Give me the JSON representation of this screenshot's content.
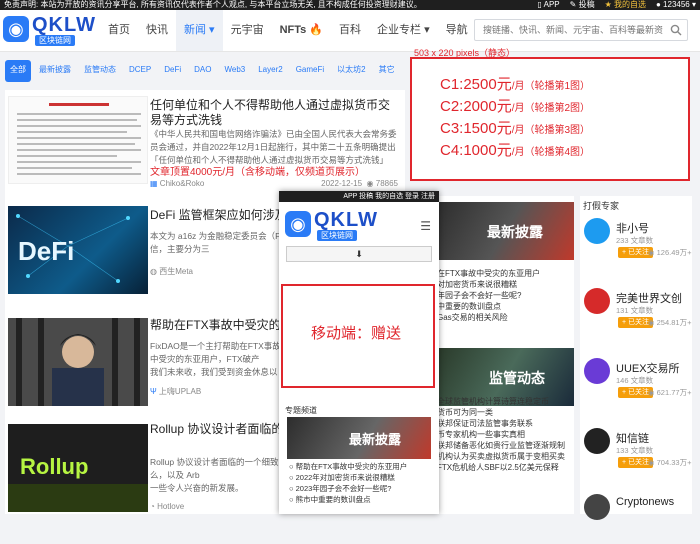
{
  "topbar": {
    "notice": "免责声明: 本站为开放的资讯分享平台, 所有资讯仅代表作者个人观点, 与本平台立场无关, 且不构成任何投资理财建议。",
    "app": "APP",
    "submit": "投稿",
    "fav": "我的自选",
    "user": "123456"
  },
  "logo": {
    "word": "QKLW",
    "sub": "区块链网"
  },
  "menu": [
    "首页",
    "快讯",
    "新闻",
    "元宇宙",
    "NFTs",
    "百科",
    "企业专栏",
    "导航"
  ],
  "search": {
    "placeholder": "搜链播、快讯、新闻、元宇宙、百科等最新资讯"
  },
  "tags": [
    "全部",
    "最新披露",
    "监管动态",
    "DCEP",
    "DeFi",
    "DAO",
    "Web3",
    "Layer2",
    "GameFi",
    "以太坊2",
    "其它"
  ],
  "banner": {
    "label": "503 x 220 pixels（静态）",
    "lines": [
      {
        "price": "C1:2500元",
        "unit": "/月",
        "note": "（轮播第1图）"
      },
      {
        "price": "C2:2000元",
        "unit": "/月",
        "note": "（轮播第2图）"
      },
      {
        "price": "C3:1500元",
        "unit": "/月",
        "note": "（轮播第3图）"
      },
      {
        "price": "C4:1000元",
        "unit": "/月",
        "note": "（轮播第4图）"
      }
    ]
  },
  "articles": [
    {
      "title": "任何单位和个人不得帮助他人通过虚拟货币交易等方式洗钱",
      "desc": "《中华人民共和国电信网络诈骗法》已由全国人民代表大会常务委员会通过，并自2022年12月1日起施行，其中第二十五条明确提出「任何单位和个人不得帮助他人通过虚拟货币交易等方式洗钱」",
      "badge": "置顶",
      "promo": "文章顶置4000元/月（含移动端，仅频道页展示）",
      "author": "Chiko&Roko",
      "date": "2022-12-15",
      "views": "78865"
    },
    {
      "title": "DeFi 监管框架应如何涉及监管",
      "desc": "本文为 a16z 为金融稳定委员会（FSB）主题活动所撰写的评论信，主要分为三",
      "author": "西生Meta",
      "thumb": "DeFi"
    },
    {
      "title": "帮助在FTX事故中受灾的东亚用户",
      "desc": "FixDAO是一个主打帮助在FTX事故中受灾的东亚用户，FTX事故中受灾的东亚用户，FTX破产",
      "desc2": "我们未来收，我们受到资金休息以",
      "author": "上嗨UPLAB"
    },
    {
      "title": "Rollup 协议设计者面临的一个攻击",
      "desc": "Rollup 协议设计者面临的一个细致问题事中，我将讨论它们是什么，以及 Arb",
      "desc2": "一些令人兴奋的新发展。",
      "author": "Hotlove",
      "thumb": "Rollup"
    }
  ],
  "mobile": {
    "topbar": "APP  投稿  我的自选  登录  注册",
    "word": "QKLW",
    "sub": "区块链网",
    "arrow": "⬇",
    "ad": "移动端：赠送",
    "channel": "专题频道",
    "banner": "最新披露",
    "list": [
      "帮助在FTX事故中受灾的东亚用户",
      "2022年对加密货币来说很糟糕",
      "2023年园子会不会好一些呢?",
      "熊市中重要的数训盘点"
    ]
  },
  "mid": {
    "banner1": "最新披露",
    "list1": [
      "在FTX事故中受灾的东亚用户",
      "对加密货币来说很糟糕",
      "年园子会不会好一些呢?",
      "中重要的数训盘点",
      "Gas交易的相关风险"
    ],
    "banner2": "监管动态",
    "list2": [
      "全球监管机构计算诗算连稳定币",
      "货币可为同一类",
      "联邦保证司法监管事务联系",
      "币专家机构一些事实真相"
    ],
    "list3": [
      "联邦储备恶化如贵行业监管逐渐规制",
      "机构认为买卖虚拟货币属于变相买卖",
      "FTX危机给人SBF以2.5亿美元保释"
    ]
  },
  "side": {
    "header": "打假专家",
    "experts": [
      {
        "name": "非小号",
        "count": "233 文章数",
        "likes": "126.49万+",
        "follow": "+ 已关注",
        "color": "#1d9bf0"
      },
      {
        "name": "完美世界文创",
        "count": "131 文章数",
        "likes": "254.81万+",
        "follow": "+ 已关注",
        "color": "#d62a2a"
      },
      {
        "name": "UUEX交易所",
        "count": "146 文章数",
        "likes": "621.77万+",
        "follow": "+ 已关注",
        "color": "#6a3bd6"
      },
      {
        "name": "知信链",
        "count": "133 文章数",
        "likes": "704.33万+",
        "follow": "+ 已关注",
        "color": "#222222"
      },
      {
        "name": "Cryptonews",
        "count": "",
        "likes": "",
        "follow": "",
        "color": "#444444"
      }
    ]
  }
}
